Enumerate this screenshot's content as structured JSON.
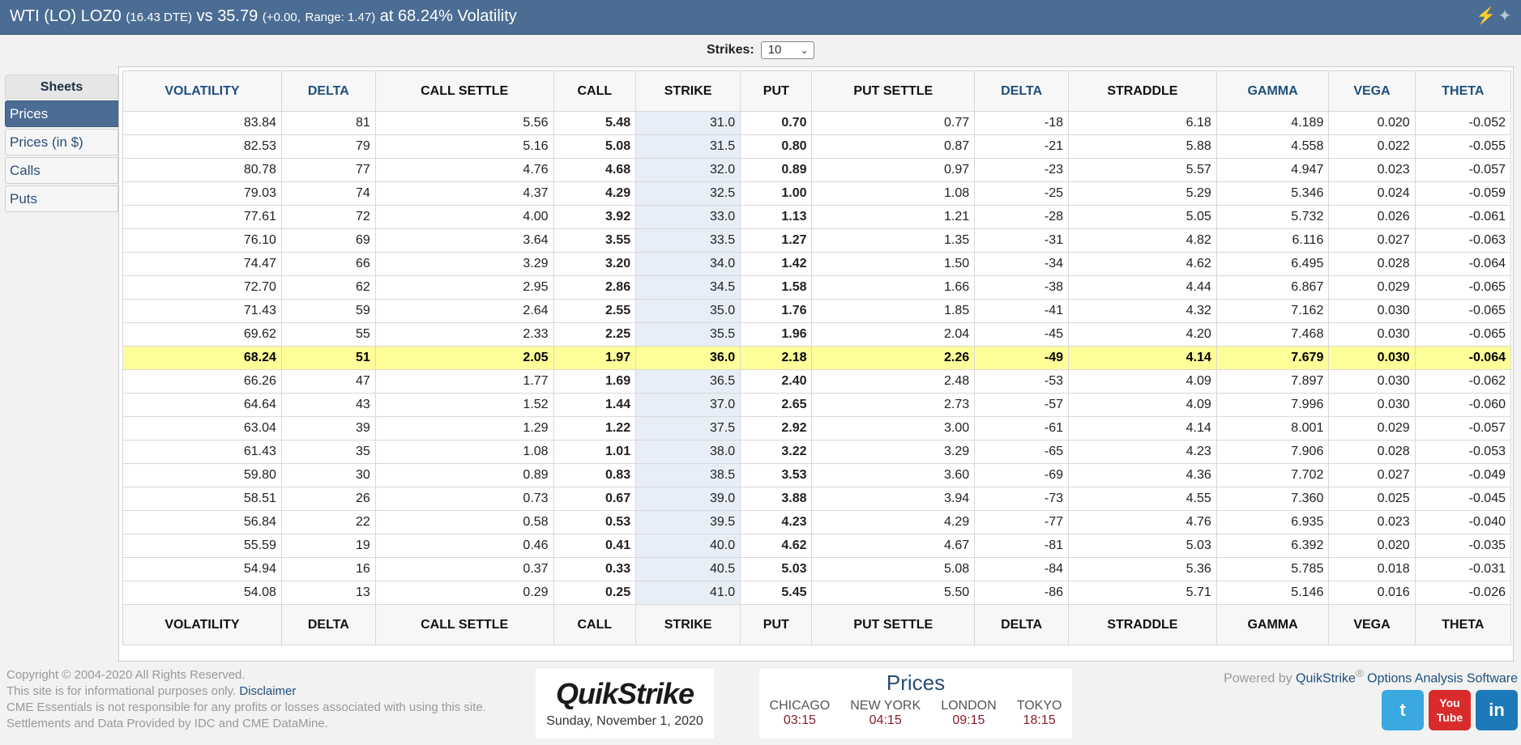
{
  "header": {
    "instrument": "WTI (LO) LOZ0",
    "dte": "(16.43 DTE)",
    "vs": "vs",
    "price": "35.79",
    "change": "(+0.00,",
    "range": "Range: 1.47)",
    "vol_text": "at 68.24% Volatility",
    "icons": [
      "lightning-icon",
      "twitter-bird-icon"
    ]
  },
  "strikes": {
    "label": "Strikes:",
    "value": "10"
  },
  "sheets": {
    "title": "Sheets",
    "items": [
      {
        "label": "Prices"
      },
      {
        "label": "Prices (in $)"
      },
      {
        "label": "Calls"
      },
      {
        "label": "Puts"
      }
    ]
  },
  "table": {
    "columns": [
      "VOLATILITY",
      "DELTA",
      "CALL SETTLE",
      "CALL",
      "STRIKE",
      "PUT",
      "PUT SETTLE",
      "DELTA",
      "STRADDLE",
      "GAMMA",
      "VEGA",
      "THETA"
    ],
    "rows": [
      [
        "83.84",
        "81",
        "5.56",
        "5.48",
        "31.0",
        "0.70",
        "0.77",
        "-18",
        "6.18",
        "4.189",
        "0.020",
        "-0.052"
      ],
      [
        "82.53",
        "79",
        "5.16",
        "5.08",
        "31.5",
        "0.80",
        "0.87",
        "-21",
        "5.88",
        "4.558",
        "0.022",
        "-0.055"
      ],
      [
        "80.78",
        "77",
        "4.76",
        "4.68",
        "32.0",
        "0.89",
        "0.97",
        "-23",
        "5.57",
        "4.947",
        "0.023",
        "-0.057"
      ],
      [
        "79.03",
        "74",
        "4.37",
        "4.29",
        "32.5",
        "1.00",
        "1.08",
        "-25",
        "5.29",
        "5.346",
        "0.024",
        "-0.059"
      ],
      [
        "77.61",
        "72",
        "4.00",
        "3.92",
        "33.0",
        "1.13",
        "1.21",
        "-28",
        "5.05",
        "5.732",
        "0.026",
        "-0.061"
      ],
      [
        "76.10",
        "69",
        "3.64",
        "3.55",
        "33.5",
        "1.27",
        "1.35",
        "-31",
        "4.82",
        "6.116",
        "0.027",
        "-0.063"
      ],
      [
        "74.47",
        "66",
        "3.29",
        "3.20",
        "34.0",
        "1.42",
        "1.50",
        "-34",
        "4.62",
        "6.495",
        "0.028",
        "-0.064"
      ],
      [
        "72.70",
        "62",
        "2.95",
        "2.86",
        "34.5",
        "1.58",
        "1.66",
        "-38",
        "4.44",
        "6.867",
        "0.029",
        "-0.065"
      ],
      [
        "71.43",
        "59",
        "2.64",
        "2.55",
        "35.0",
        "1.76",
        "1.85",
        "-41",
        "4.32",
        "7.162",
        "0.030",
        "-0.065"
      ],
      [
        "69.62",
        "55",
        "2.33",
        "2.25",
        "35.5",
        "1.96",
        "2.04",
        "-45",
        "4.20",
        "7.468",
        "0.030",
        "-0.065"
      ],
      [
        "68.24",
        "51",
        "2.05",
        "1.97",
        "36.0",
        "2.18",
        "2.26",
        "-49",
        "4.14",
        "7.679",
        "0.030",
        "-0.064"
      ],
      [
        "66.26",
        "47",
        "1.77",
        "1.69",
        "36.5",
        "2.40",
        "2.48",
        "-53",
        "4.09",
        "7.897",
        "0.030",
        "-0.062"
      ],
      [
        "64.64",
        "43",
        "1.52",
        "1.44",
        "37.0",
        "2.65",
        "2.73",
        "-57",
        "4.09",
        "7.996",
        "0.030",
        "-0.060"
      ],
      [
        "63.04",
        "39",
        "1.29",
        "1.22",
        "37.5",
        "2.92",
        "3.00",
        "-61",
        "4.14",
        "8.001",
        "0.029",
        "-0.057"
      ],
      [
        "61.43",
        "35",
        "1.08",
        "1.01",
        "38.0",
        "3.22",
        "3.29",
        "-65",
        "4.23",
        "7.906",
        "0.028",
        "-0.053"
      ],
      [
        "59.80",
        "30",
        "0.89",
        "0.83",
        "38.5",
        "3.53",
        "3.60",
        "-69",
        "4.36",
        "7.702",
        "0.027",
        "-0.049"
      ],
      [
        "58.51",
        "26",
        "0.73",
        "0.67",
        "39.0",
        "3.88",
        "3.94",
        "-73",
        "4.55",
        "7.360",
        "0.025",
        "-0.045"
      ],
      [
        "56.84",
        "22",
        "0.58",
        "0.53",
        "39.5",
        "4.23",
        "4.29",
        "-77",
        "4.76",
        "6.935",
        "0.023",
        "-0.040"
      ],
      [
        "55.59",
        "19",
        "0.46",
        "0.41",
        "40.0",
        "4.62",
        "4.67",
        "-81",
        "5.03",
        "6.392",
        "0.020",
        "-0.035"
      ],
      [
        "54.94",
        "16",
        "0.37",
        "0.33",
        "40.5",
        "5.03",
        "5.08",
        "-84",
        "5.36",
        "5.785",
        "0.018",
        "-0.031"
      ],
      [
        "54.08",
        "13",
        "0.29",
        "0.25",
        "41.0",
        "5.45",
        "5.50",
        "-86",
        "5.71",
        "5.146",
        "0.016",
        "-0.026"
      ]
    ],
    "atm_strike": "36.0"
  },
  "footer": {
    "copyright": "Copyright © 2004-2020 All Rights Reserved.",
    "info": "This site is for informational purposes only.",
    "disclaimer": "Disclaimer",
    "cme": "CME Essentials is not responsible for any profits or losses associated with using this site.",
    "settlements": "Settlements and Data Provided by IDC and CME DataMine.",
    "logo_text": "QuikStrike",
    "date": "Sunday, November 1, 2020",
    "prices_title": "Prices",
    "cities": [
      {
        "name": "CHICAGO",
        "time": "03:15"
      },
      {
        "name": "NEW YORK",
        "time": "04:15"
      },
      {
        "name": "LONDON",
        "time": "09:15"
      },
      {
        "name": "TOKYO",
        "time": "18:15"
      }
    ],
    "powered_prefix": "Powered by",
    "powered_brand": "QuikStrike",
    "powered_suffix": "Options Analysis Software",
    "social": [
      {
        "icon": "twitter-icon",
        "glyph": "t",
        "color": "#39a9e0"
      },
      {
        "icon": "youtube-icon",
        "glyph": "You\nTube",
        "color": "#d92b2b"
      },
      {
        "icon": "linkedin-icon",
        "glyph": "in",
        "color": "#1d7ab8"
      }
    ]
  }
}
